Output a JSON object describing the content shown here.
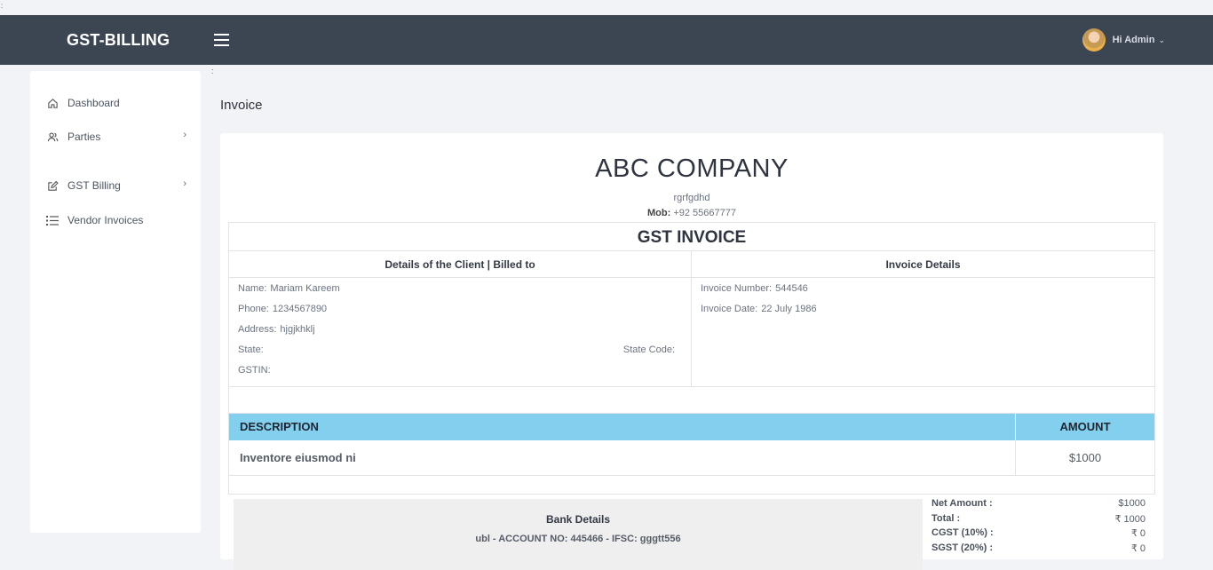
{
  "corner_mark": ":",
  "header": {
    "brand": "GST-BILLING",
    "greeting": "Hi Admin",
    "caret": "⌄"
  },
  "sidebar": {
    "items": [
      {
        "label": "Dashboard",
        "icon": "home-icon"
      },
      {
        "label": "Parties",
        "icon": "users-icon",
        "chevron": "›"
      },
      {
        "label": "GST Billing",
        "icon": "edit-icon",
        "chevron": "›"
      },
      {
        "label": "Vendor Invoices",
        "icon": "list-icon"
      }
    ]
  },
  "page": {
    "colon": ":",
    "title": "Invoice"
  },
  "invoice": {
    "company": "ABC COMPANY",
    "address": "rgrfgdhd",
    "mob_label": "Mob:",
    "mob_value": "+92 55667777",
    "doc_title": "GST INVOICE",
    "client_heading": "Details of the Client | Billed to",
    "invoice_heading": "Invoice Details",
    "client": {
      "name_label": "Name:",
      "name": "Mariam Kareem",
      "phone_label": "Phone:",
      "phone": "1234567890",
      "address_label": "Address:",
      "address": "hjgjkhklj",
      "state_label": "State:",
      "state": "",
      "state_code_label": "State Code:",
      "state_code": "",
      "gstin_label": "GSTIN:",
      "gstin": ""
    },
    "details": {
      "number_label": "Invoice Number:",
      "number": "544546",
      "date_label": "Invoice Date:",
      "date": "22 July 1986"
    },
    "table": {
      "headers": [
        "DESCRIPTION",
        "AMOUNT"
      ],
      "rows": [
        {
          "description": "Inventore eiusmod ni",
          "amount": "$1000"
        }
      ],
      "header_color": "#83cfee"
    },
    "bank": {
      "title": "Bank Details",
      "line": "ubl - ACCOUNT NO: 445466 - IFSC: gggtt556"
    },
    "totals": [
      {
        "label": "Net Amount :",
        "value": "$1000"
      },
      {
        "label": "Total :",
        "value": "₹ 1000"
      },
      {
        "label": "CGST (10%) :",
        "value": "₹ 0"
      },
      {
        "label": "SGST (20%) :",
        "value": "₹ 0"
      }
    ]
  }
}
